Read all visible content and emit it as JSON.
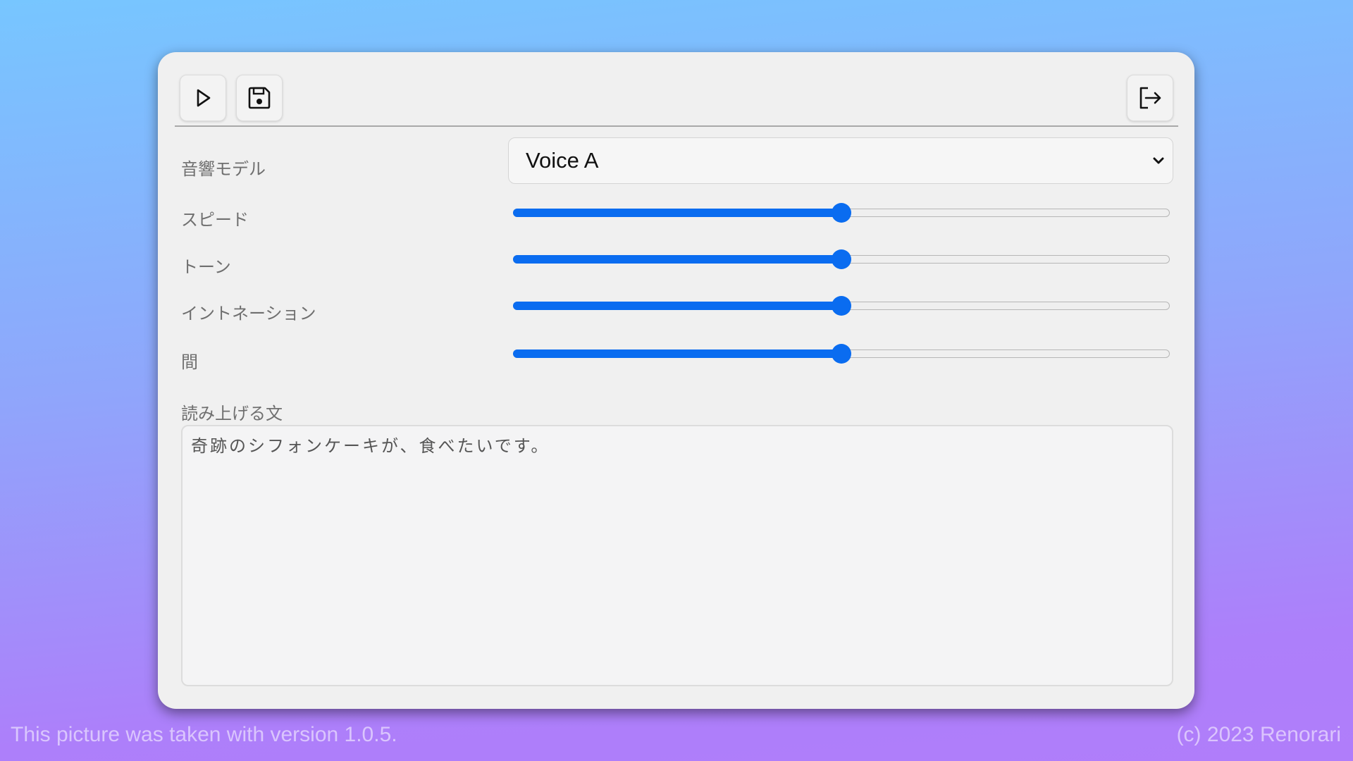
{
  "toolbar": {
    "play_icon": "play-icon",
    "save_icon": "floppy-disk-icon",
    "exit_icon": "logout-icon"
  },
  "form": {
    "model_label": "音響モデル",
    "model_value": "Voice A",
    "speed_label": "スピード",
    "speed_value": 0.5,
    "tone_label": "トーン",
    "tone_value": 0.5,
    "intonation_label": "イントネーション",
    "intonation_value": 0.5,
    "pause_label": "間",
    "pause_value": 0.5,
    "text_label": "読み上げる文",
    "text_value": "奇跡のシフォンケーキが、食べたいです。"
  },
  "footer": {
    "left": "This picture was taken with version 1.0.5.",
    "right": "(c) 2023 Renorari"
  },
  "colors": {
    "accent": "#0a6cf0",
    "window_bg": "#f0f0f0"
  }
}
